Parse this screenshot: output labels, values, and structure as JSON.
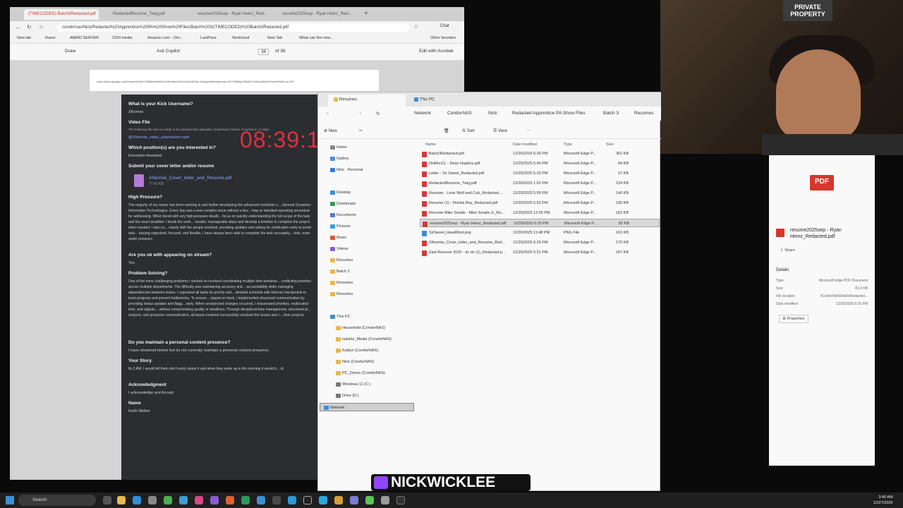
{
  "browser": {
    "tabs": [
      {
        "label": "(TIMECODED) Batch3Redacted.pdf"
      },
      {
        "label": "RedactedResume_Twig.pdf"
      },
      {
        "label": "resume2025sep - Ryan Heinz_Red..."
      },
      {
        "label": "resume2025sep - Ryan Heinz_Red..."
      }
    ],
    "url": "condornas/Nick/Redacted%20Apprentice%20PA%20Show%20Files/Batch%203/(TIMECODED)%20Batch3Redacted.pdf",
    "chat_label": "Chat",
    "favorites": [
      "New tab",
      "Razer",
      "AMMO SERVER",
      "CDN media",
      "Amazon.com - Onl...",
      "LastPass",
      "Nextcloud",
      "New Tab",
      "What can the new..."
    ],
    "other_favorites": "Other favorites",
    "pdf_toolbar": {
      "draw": "Draw",
      "ask_copilot": "Ask Copilot",
      "page": "36",
      "of_pages": "of 36",
      "edit_acrobat": "Edit with Acrobat"
    },
    "strip_text": "https://docs.google.com/forms/d/1aHCVM6tMmv9MiJ1b15uHAeiJGsivnOwxNCNo-kXpgc/edit#response=ACYDBNjnV5NjfVTmHi6dp3hbSZ4mvbI0uM-xxx",
    "strip_page": "3/3"
  },
  "doc": {
    "kick_q": "What is your Kick Username?",
    "kick_a": "XNormie",
    "video_q": "Video File",
    "video_note": "The following file was too large to be permanently uploaded. Download it before it expires in 14 days",
    "video_link": "@XNormie_video_submission.mp4",
    "position_q": "Which position(s) are you interested in?",
    "position_a": "Executive Assistant",
    "cover_q": "Submit your cover letter and/or resume",
    "cover_file": "XNormie_Cover_letter_and_Resume.pdf",
    "cover_size": "77.42 KB",
    "pressure_q": "High Pressure?",
    "pressure_a": "The majority of my career has been working in and further developing the advanced resolution c... General Dynamics Information Technologies. Every day was a new complex issue without a dev... map or standard operating procedure for addressing. When faced with any high-pressure deadli... focus on quickly understanding the full scope of the task and the exact deadline. I break the work... smaller, manageable steps and develop a timeline to complete the project when needed. I also co... clearly with the people involved, providing updates and asking for clarification early to avoid mist... staying organized, focused, and flexible, I have always been able to complete the task accurately... time, even under pressure.",
    "stream_q": "Are you ok with appearing on stream?",
    "stream_a": "Yes",
    "problem_q": "Problem Solving?",
    "problem_a": "One of the more challenging problems I worked on involved coordinating multiple time-sensitive... conflicting priorities across multiple departments. The difficulty was maintaining accuracy and... accountability while managing dependencies between teams. I organized all tasks by priority and... detailed schedule with internal checkpoints to track progress and prevent bottlenecks. To ensure... stayed on track, I implemented structured communication by providing status updates and flagg... early. When unexpected changes occurred, I reassessed priorities, reallocated time, and adjuste... without compromising quality or deadlines. Through disciplined time management, structured pl... analysis, and proactive communication, all teams involved successfully resolved the issues and c... their projects",
    "content_q": "Do you maintain a personal content presence?",
    "content_a": "I have streamed before but do not currently maintain a personal content presence.",
    "story_q": "Your Story.",
    "story_a": "Its 2 AM, I would tell them don't worry about it and when they woke up in the morning it would b... of.",
    "ack_q": "Acknowledgment",
    "ack_a": "I acknowledge and Accept",
    "name_q": "Name",
    "name_a": "Keith Welker"
  },
  "timer": "08:39:1",
  "explorer": {
    "tabs": [
      "Resumes",
      "This PC"
    ],
    "breadcrumb": [
      "Network",
      "CondorNAS",
      "Nick",
      "Redacted Apprentice PA Show Files",
      "Batch 3",
      "Resumes"
    ],
    "commands": {
      "new": "New",
      "sort": "Sort",
      "view": "View"
    },
    "sidebar_top": [
      "Home",
      "Gallery",
      "Nick - Personal"
    ],
    "sidebar_pinned": [
      "Desktop",
      "Downloads",
      "Documents",
      "Pictures",
      "Music",
      "Videos",
      "Resumes",
      "Batch 2",
      "Resumes",
      "Resumes"
    ],
    "sidebar_pc": [
      "This PC",
      "Household (CondorNAS)",
      "Isaiahs_Media (CondorNAS)",
      "Kaitlyn (CondorNAS)",
      "Nick (CondorNAS)",
      "PC_Drives (CondorNAS)",
      "Windows 11 (C:)",
      "Drive (D:)",
      "Network"
    ],
    "columns": {
      "name": "Name",
      "date": "Date modified",
      "type": "Type",
      "size": "Size"
    },
    "files": [
      {
        "name": "Batch3Redacted.pdf",
        "date": "12/26/2025 6:30 PM",
        "type": "Microsoft Edge P...",
        "size": "361 KB",
        "kind": "pdf"
      },
      {
        "name": "DHRecCL - Dean Hughes.pdf",
        "date": "12/25/2025 5:40 PM",
        "type": "Microsoft Edge P...",
        "size": "84 KB",
        "kind": "pdf"
      },
      {
        "name": "Letter - Sir Sweet_Redacted.pdf",
        "date": "12/25/2025 5:33 PM",
        "type": "Microsoft Edge P...",
        "size": "37 KB",
        "kind": "pdf"
      },
      {
        "name": "RedactedResume_Twig.pdf",
        "date": "12/26/2025 1:02 PM",
        "type": "Microsoft Edge P...",
        "size": "124 KB",
        "kind": "pdf"
      },
      {
        "name": "Resume - Lone Wolf and Cub_Redacted....",
        "date": "12/25/2025 5:55 PM",
        "type": "Microsoft Edge P...",
        "size": "140 KB",
        "kind": "pdf"
      },
      {
        "name": "Resume (1) - Florida Boy_Redacted.pdf",
        "date": "12/25/2025 5:52 PM",
        "type": "Microsoft Edge P...",
        "size": "105 KB",
        "kind": "pdf"
      },
      {
        "name": "Resume Mike Smalls - Mike Smalls Jr_Re...",
        "date": "12/25/2025 12:55 PM",
        "type": "Microsoft Edge P...",
        "size": "162 KB",
        "kind": "pdf"
      },
      {
        "name": "resume2025sep - Ryan Heinz_Redacted.pdf",
        "date": "12/26/2025 6:25 PM",
        "type": "Microsoft Edge P...",
        "size": "82 KB",
        "kind": "pdf",
        "selected": true
      },
      {
        "name": "SirSweet_HeadMod.png",
        "date": "12/26/2025 11:48 PM",
        "type": "PNG File",
        "size": "161 KB",
        "kind": "png"
      },
      {
        "name": "XNormie_Cover_letter_and_Resume_Red...",
        "date": "12/26/2025 6:26 PM",
        "type": "Microsoft Edge P...",
        "size": "170 KB",
        "kind": "pdf"
      },
      {
        "name": "Zaid Resume 2025 - dv dv (1)_Redacted.p...",
        "date": "12/25/2025 5:31 PM",
        "type": "Microsoft Edge P...",
        "size": "187 KB",
        "kind": "pdf"
      }
    ]
  },
  "details": {
    "badge": "PDF",
    "filename": "resume2025sep - Ryan Heinz_Redacted.pdf",
    "share": "Share",
    "section": "Details",
    "rows": [
      {
        "label": "Type",
        "value": "Microsoft Edge PDF Document"
      },
      {
        "label": "Size",
        "value": "81.0 KB"
      },
      {
        "label": "File location",
        "value": "\\\\CondorNAS\\Nick\\Redacted..."
      },
      {
        "label": "Date modified",
        "value": "12/26/2025 6:25 PM"
      }
    ],
    "properties": "Properties"
  },
  "webcam": {
    "poster": "PRIVATE PROPERTY"
  },
  "brand": "NICKWICKLEE",
  "taskbar": {
    "search": "Search",
    "time": "3:40 AM",
    "date": "12/27/2025"
  },
  "colors": {
    "pdf_red": "#d6372c",
    "twitch": "#9146ff",
    "timer_red": "#e03040"
  }
}
